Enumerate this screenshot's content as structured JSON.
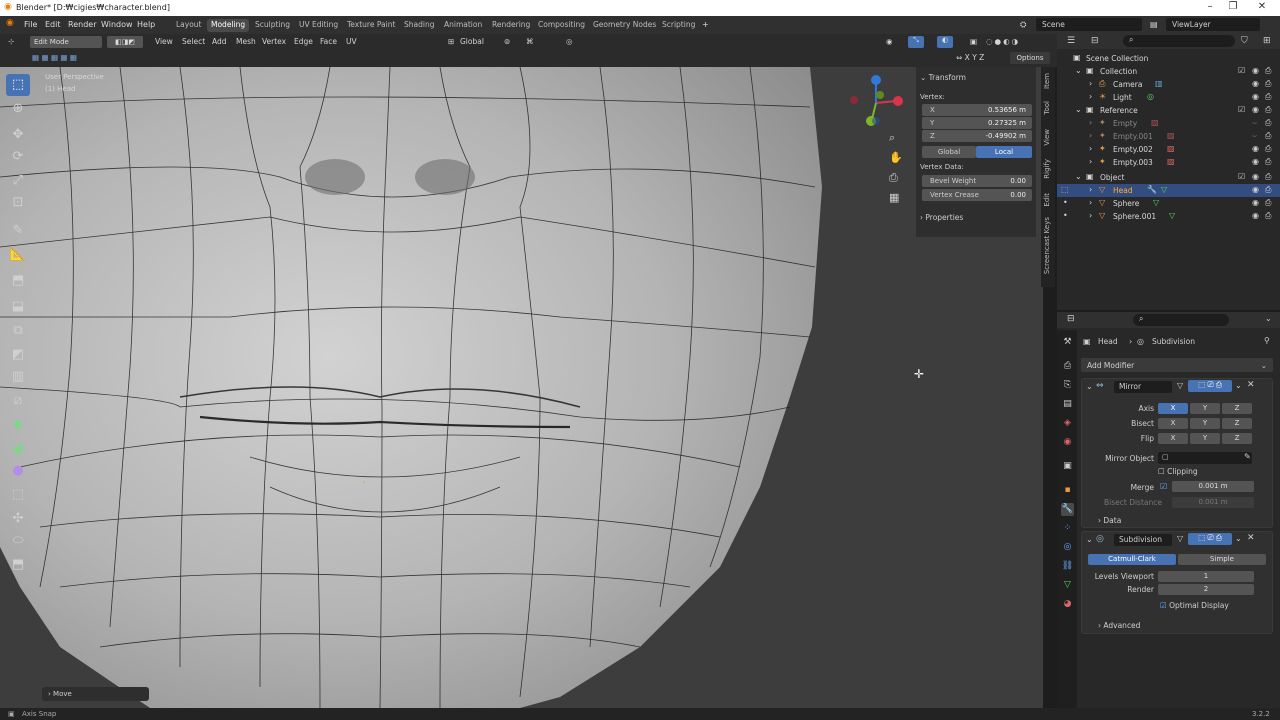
{
  "title_bar": {
    "title": "Blender* [D:₩cigies₩character.blend]"
  },
  "menu": {
    "file": "File",
    "edit": "Edit",
    "render": "Render",
    "window": "Window",
    "help": "Help"
  },
  "workspaces": [
    "Layout",
    "Modeling",
    "Sculpting",
    "UV Editing",
    "Texture Paint",
    "Shading",
    "Animation",
    "Rendering",
    "Compositing",
    "Geometry Nodes",
    "Scripting"
  ],
  "scene": {
    "name": "Scene",
    "view_layer": "ViewLayer"
  },
  "header": {
    "mode": "Edit Mode",
    "view": "View",
    "select": "Select",
    "add": "Add",
    "mesh": "Mesh",
    "vertex": "Vertex",
    "edge": "Edge",
    "face": "Face",
    "uv": "UV",
    "orientation": "Global",
    "options": "Options"
  },
  "viewport": {
    "perspective": "User Perspective",
    "object": "(1) Head",
    "operator": "Move"
  },
  "npanel": {
    "section": "Transform",
    "vertex_label": "Vertex:",
    "x_label": "X",
    "x": "0.53656 m",
    "y_label": "Y",
    "y": "0.27325 m",
    "z_label": "Z",
    "z": "-0.49902 m",
    "global": "Global",
    "local": "Local",
    "vertex_data": "Vertex Data:",
    "bevel_label": "Bevel Weight",
    "bevel": "0.00",
    "crease_label": "Vertex Crease",
    "crease": "0.00",
    "properties": "Properties",
    "tabs": [
      "Item",
      "Tool",
      "View",
      "Rigify",
      "Edit",
      "Screencast Keys"
    ]
  },
  "outliner": {
    "root": "Scene Collection",
    "rows": [
      {
        "label": "Collection"
      },
      {
        "label": "Camera"
      },
      {
        "label": "Light"
      },
      {
        "label": "Reference"
      },
      {
        "label": "Empty"
      },
      {
        "label": "Empty.001"
      },
      {
        "label": "Empty.002"
      },
      {
        "label": "Empty.003"
      },
      {
        "label": "Object"
      },
      {
        "label": "Head"
      },
      {
        "label": "Sphere"
      },
      {
        "label": "Sphere.001"
      }
    ]
  },
  "properties": {
    "breadcrumb_object": "Head",
    "breadcrumb_modifier": "Subdivision",
    "add_modifier": "Add Modifier",
    "mirror": {
      "name": "Mirror",
      "axis": "Axis",
      "bisect": "Bisect",
      "flip": "Flip",
      "x": "X",
      "y": "Y",
      "z": "Z",
      "mirror_object": "Mirror Object",
      "clipping": "Clipping",
      "merge": "Merge",
      "merge_value": "0.001 m",
      "bisect_distance": "Bisect Distance",
      "bisect_distance_value": "0.001 m",
      "data": "Data"
    },
    "subdivision": {
      "name": "Subdivision",
      "catmull": "Catmull-Clark",
      "simple": "Simple",
      "levels_viewport": "Levels Viewport",
      "levels_viewport_value": "1",
      "render": "Render",
      "render_value": "2",
      "optimal_display": "Optimal Display",
      "advanced": "Advanced"
    }
  },
  "status": {
    "left": "Axis Snap",
    "version": "3.2.2"
  },
  "colors": {
    "accent": "#4772b3",
    "selection": "#334d80",
    "panel": "#303030",
    "viewport": "#3d3d3d"
  }
}
